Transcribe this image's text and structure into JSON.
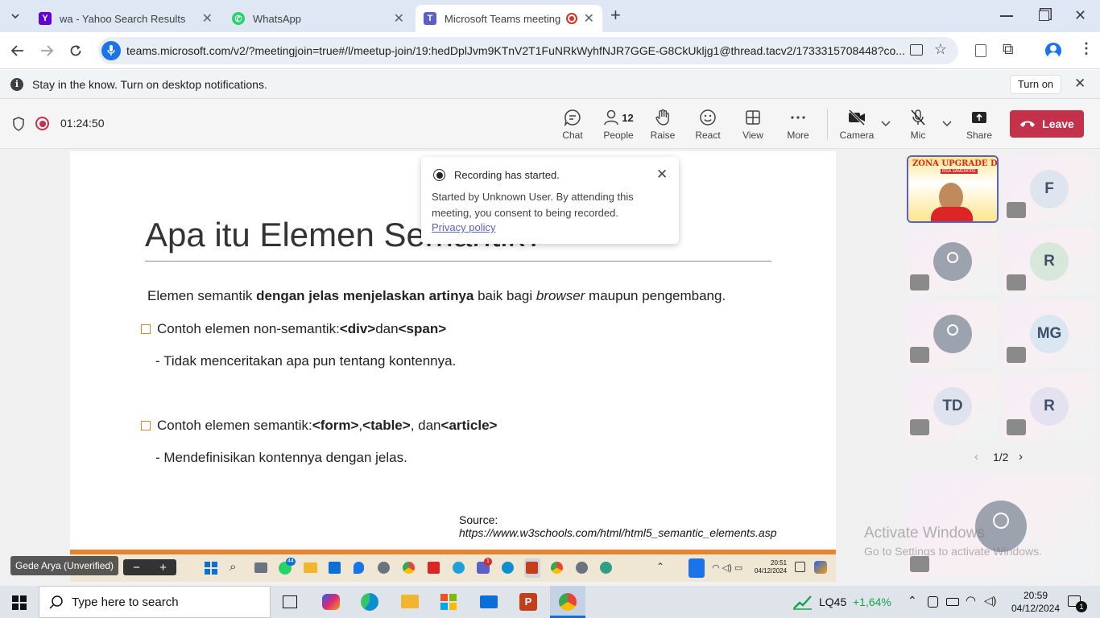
{
  "browser": {
    "tabs": [
      {
        "title": "wa - Yahoo Search Results",
        "icon": "yahoo-icon"
      },
      {
        "title": "WhatsApp",
        "icon": "whatsapp-icon"
      },
      {
        "title": "Microsoft Teams meeting | M",
        "icon": "teams-icon"
      }
    ],
    "url": "teams.microsoft.com/v2/?meetingjoin=true#/l/meetup-join/19:hedDplJvm9KTnV2T1FuNRkWyhfNJR7GGE-G8CkUkljg1@thread.tacv2/1733315708448?co..."
  },
  "infobar": {
    "message": "Stay in the know. Turn on desktop notifications.",
    "button": "Turn on"
  },
  "meeting": {
    "timer": "01:24:50",
    "controls": {
      "chat": "Chat",
      "people": "People",
      "people_count": "12",
      "raise": "Raise",
      "react": "React",
      "view": "View",
      "more": "More",
      "camera": "Camera",
      "mic": "Mic",
      "share": "Share",
      "leave": "Leave"
    }
  },
  "recording_toast": {
    "title": "Recording has started.",
    "body": "Started by Unknown User. By attending this meeting, you consent to being recorded.",
    "link": "Privacy policy"
  },
  "slide": {
    "title_visible": "Apa itu Elemen Se",
    "title_tail": "mantik?",
    "intro": {
      "p1": "Elemen semantik ",
      "bold": "dengan jelas menjelaskan artinya",
      "p2": " baik bagi ",
      "italic": "browser",
      "p3": " maupun pengembang."
    },
    "bullet1": {
      "text": "Contoh elemen non-semantik: ",
      "tag1": "<div>",
      "mid": " dan ",
      "tag2": "<span>"
    },
    "sub1": "- Tidak menceritakan apa pun tentang kontennya.",
    "bullet2": {
      "text": "Contoh elemen semantik: ",
      "tag1": "<form>",
      "sep1": ", ",
      "tag2": "<table>",
      "sep2": ", dan ",
      "tag3": "<article>"
    },
    "sub2": "- Mendefinisikan kontennya dengan jelas.",
    "source_label": "Source:",
    "source_url": "https://www.w3schools.com/html/html5_semantic_elements.asp"
  },
  "presenter_taskbar": {
    "time": "20:51",
    "date": "04/12/2024",
    "whatsapp_badge": "44",
    "teams_badge": "1"
  },
  "presenter_label": "Gede Arya (Unverified)",
  "participants": [
    {
      "initials": "",
      "video_banner": "ZONA UPGRADE DIRI",
      "video_sub": "BISA SAMEMODE",
      "pinned": true
    },
    {
      "initials": "F"
    },
    {
      "initials": ""
    },
    {
      "initials": "R"
    },
    {
      "initials": ""
    },
    {
      "initials": "MG"
    },
    {
      "initials": "TD"
    },
    {
      "initials": "R"
    }
  ],
  "pager": "1/2",
  "watermark": {
    "line1": "Activate Windows",
    "line2": "Go to Settings to activate Windows."
  },
  "taskbar": {
    "search_placeholder": "Type here to search",
    "stock_name": "LQ45",
    "stock_change": "+1,64%",
    "time": "20:59",
    "date": "04/12/2024",
    "notifications": "1"
  },
  "colors": {
    "leave": "#c4314b",
    "teams_purple": "#5b5fc7",
    "slide_accent": "#e8822c",
    "stock_up": "#16a34a"
  }
}
